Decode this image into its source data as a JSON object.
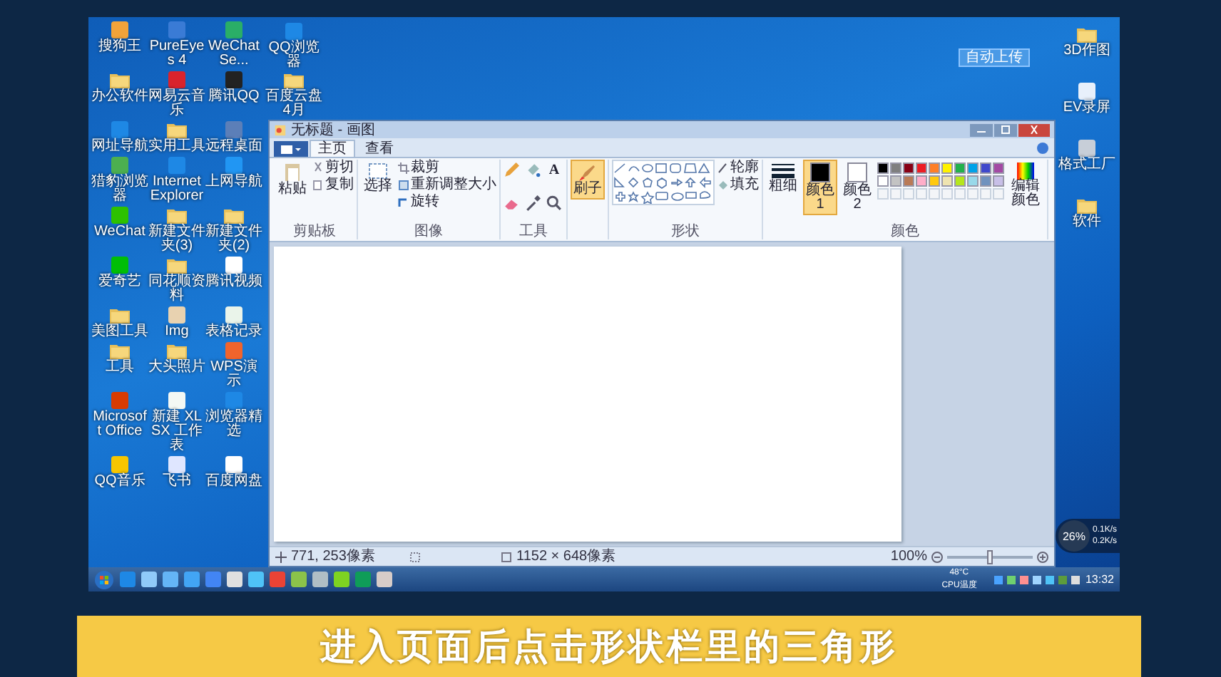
{
  "desktop": {
    "left_icons": [
      {
        "label": "搜狗王",
        "kind": "app",
        "color": "#f2a33a"
      },
      {
        "label": "PureEyes 4",
        "kind": "app",
        "color": "#3a7bd5"
      },
      {
        "label": "WeChatSe...",
        "kind": "app",
        "color": "#2aae67"
      },
      {
        "label": "办公软件",
        "kind": "folder"
      },
      {
        "label": "网易云音乐",
        "kind": "app",
        "color": "#d9232d"
      },
      {
        "label": "腾讯QQ",
        "kind": "app",
        "color": "#222222"
      },
      {
        "label": "网址导航",
        "kind": "app",
        "color": "#1e88e5"
      },
      {
        "label": "实用工具",
        "kind": "folder"
      },
      {
        "label": "远程桌面",
        "kind": "app",
        "color": "#5c7fb8"
      },
      {
        "label": "猎豹浏览器",
        "kind": "app",
        "color": "#4caf50"
      },
      {
        "label": "Internet Explorer",
        "kind": "app",
        "color": "#1e88e5"
      },
      {
        "label": "上网导航",
        "kind": "app",
        "color": "#2196f3"
      },
      {
        "label": "WeChat",
        "kind": "app",
        "color": "#2dc100"
      },
      {
        "label": "新建文件夹(3)",
        "kind": "folder"
      },
      {
        "label": "新建文件夹(2)",
        "kind": "folder"
      },
      {
        "label": "爱奇艺",
        "kind": "app",
        "color": "#00be06"
      },
      {
        "label": "同花顺资料",
        "kind": "folder"
      },
      {
        "label": "腾讯视频",
        "kind": "app",
        "color": "#ffffff"
      },
      {
        "label": "美图工具",
        "kind": "folder"
      },
      {
        "label": "Img",
        "kind": "app",
        "color": "#e8d2b0"
      },
      {
        "label": "表格记录",
        "kind": "app",
        "color": "#eaf4ea"
      },
      {
        "label": "工具",
        "kind": "folder"
      },
      {
        "label": "大头照片",
        "kind": "folder"
      },
      {
        "label": "WPS演示",
        "kind": "app",
        "color": "#f0642d"
      },
      {
        "label": "Microsoft Office",
        "kind": "app",
        "color": "#d83b01"
      },
      {
        "label": "新建 XLSX 工作表",
        "kind": "app",
        "color": "#f4f8f4"
      },
      {
        "label": "浏览器精选",
        "kind": "app",
        "color": "#1e88e5"
      },
      {
        "label": "QQ音乐",
        "kind": "app",
        "color": "#f7c600"
      },
      {
        "label": "飞书",
        "kind": "app",
        "color": "#dfe6ff"
      },
      {
        "label": "百度网盘",
        "kind": "app",
        "color": "#ffffff"
      }
    ],
    "top_icons": [
      {
        "label": "QQ浏览器",
        "kind": "app",
        "color": "#1e88e5"
      },
      {
        "label": "百度云盘4月",
        "kind": "folder"
      }
    ],
    "right_icons": [
      {
        "label": "3D作图",
        "kind": "folder"
      },
      {
        "label": "EV录屏",
        "kind": "app",
        "color": "#e8f0fb"
      },
      {
        "label": "格式工厂",
        "kind": "app",
        "color": "#c7ced8"
      },
      {
        "label": "软件",
        "kind": "folder"
      }
    ],
    "upload_button": {
      "label": "自动上传"
    },
    "net_widget": {
      "percent": "26%",
      "up": "0.1K/s",
      "down": "0.2K/s"
    }
  },
  "paint": {
    "title": "无标题 - 画图",
    "tabs": [
      {
        "label": "主页",
        "selected": true
      },
      {
        "label": "查看",
        "selected": false
      }
    ],
    "clipboard": {
      "paste": "粘贴",
      "cut": "剪切",
      "copy": "复制",
      "group": "剪贴板"
    },
    "image": {
      "select": "选择",
      "crop": "裁剪",
      "resize": "重新调整大小",
      "rotate": "旋转",
      "group": "图像"
    },
    "tools": {
      "text_tool": "A",
      "group": "工具"
    },
    "brush": {
      "label": "刷子",
      "selected": true
    },
    "shapes": {
      "outline": "轮廓",
      "fill": "填充",
      "group": "形状"
    },
    "size": {
      "label": "粗细"
    },
    "color_slots": [
      {
        "label": "颜色 1",
        "selected": true,
        "color": "#000000"
      },
      {
        "label": "颜色 2",
        "selected": false,
        "color": "#ffffff"
      }
    ],
    "palette": [
      {
        "kind": "color",
        "color": "#000000"
      },
      {
        "kind": "color",
        "color": "#7f7f7f"
      },
      {
        "kind": "color",
        "color": "#880015"
      },
      {
        "kind": "color",
        "color": "#ed1c24"
      },
      {
        "kind": "color",
        "color": "#ff7f27"
      },
      {
        "kind": "color",
        "color": "#fff200"
      },
      {
        "kind": "color",
        "color": "#22b14c"
      },
      {
        "kind": "color",
        "color": "#00a2e8"
      },
      {
        "kind": "color",
        "color": "#3f48cc"
      },
      {
        "kind": "color",
        "color": "#a349a4"
      },
      {
        "kind": "color",
        "color": "#ffffff"
      },
      {
        "kind": "color",
        "color": "#c3c3c3"
      },
      {
        "kind": "color",
        "color": "#b97a57"
      },
      {
        "kind": "color",
        "color": "#ffaec9"
      },
      {
        "kind": "color",
        "color": "#ffc90e"
      },
      {
        "kind": "color",
        "color": "#efe4b0"
      },
      {
        "kind": "color",
        "color": "#b5e61d"
      },
      {
        "kind": "color",
        "color": "#99d9ea"
      },
      {
        "kind": "color",
        "color": "#7092be"
      },
      {
        "kind": "color",
        "color": "#c8bfe7"
      },
      {
        "kind": "empty"
      },
      {
        "kind": "empty"
      },
      {
        "kind": "empty"
      },
      {
        "kind": "empty"
      },
      {
        "kind": "empty"
      },
      {
        "kind": "empty"
      },
      {
        "kind": "empty"
      },
      {
        "kind": "empty"
      },
      {
        "kind": "empty"
      },
      {
        "kind": "empty"
      }
    ],
    "edit_colors": "编辑颜色",
    "colors_group": "颜色",
    "status": {
      "cursor": "771, 253像素",
      "canvas_size": "1152 × 648像素",
      "zoom": "100%",
      "zoom_level": {
        "level": 0.5
      }
    }
  },
  "taskbar": {
    "pinned": [
      {
        "color": "#1e88e5"
      },
      {
        "color": "#90caf9"
      },
      {
        "color": "#64b5f6"
      },
      {
        "color": "#42a5f5"
      },
      {
        "color": "#4285f4"
      },
      {
        "color": "#e0e0e0"
      },
      {
        "color": "#4fc3f7"
      },
      {
        "color": "#ea4335"
      },
      {
        "color": "#8bc34a"
      },
      {
        "color": "#b0bec5"
      },
      {
        "color": "#7ed321"
      },
      {
        "color": "#0f9d58"
      },
      {
        "color": "#d7ccc8"
      }
    ],
    "temperature": "48°C",
    "temp_label": "CPU温度",
    "clock": "13:32"
  },
  "caption": "进入页面后点击形状栏里的三角形"
}
